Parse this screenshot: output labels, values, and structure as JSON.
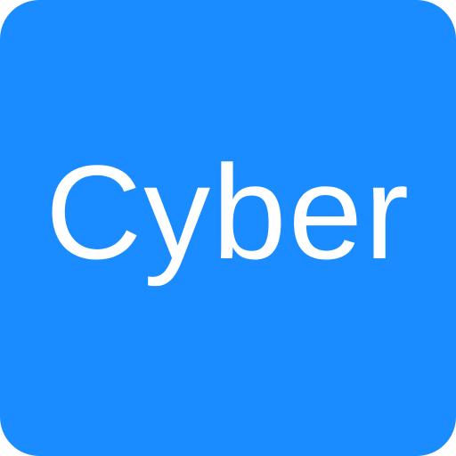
{
  "icon": {
    "label": "Cyber",
    "background_color": "#1a8cff",
    "text_color": "#ffffff",
    "shape": "rounded-square"
  }
}
